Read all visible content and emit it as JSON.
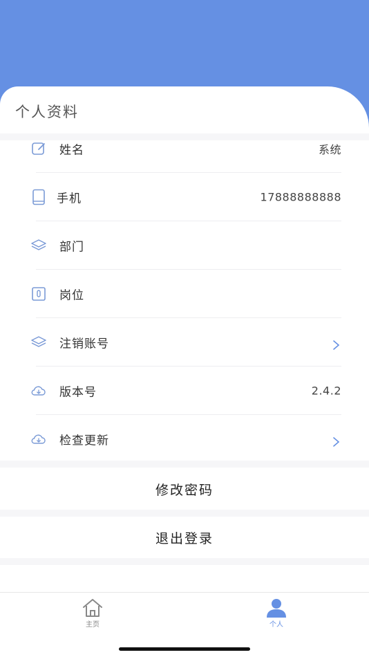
{
  "colors": {
    "header": "#6590e3",
    "accent": "#6590e3",
    "icon": "#7a9ad6",
    "tab_inactive": "#888888"
  },
  "page_title": "个人资料",
  "rows": [
    {
      "label": "姓名",
      "value": "系统",
      "icon": "edit-icon"
    },
    {
      "label": "手机",
      "value": "17888888888",
      "icon": "phone-icon"
    },
    {
      "label": "部门",
      "value": "",
      "icon": "layers-icon"
    },
    {
      "label": "岗位",
      "value": "",
      "icon": "badge-icon"
    },
    {
      "label": "注销账号",
      "value": "",
      "icon": "layers-icon",
      "chevron": "chevron-right-icon"
    },
    {
      "label": "版本号",
      "value": "2.4.2",
      "icon": "cloud-download-icon"
    },
    {
      "label": "检查更新",
      "value": "",
      "icon": "cloud-download-icon",
      "chevron": "chevron-right-icon"
    }
  ],
  "actions": {
    "change_password": "修改密码",
    "logout": "退出登录"
  },
  "tabbar": {
    "home": {
      "label": "主页",
      "icon": "home-icon"
    },
    "profile": {
      "label": "个人",
      "icon": "person-icon"
    }
  }
}
